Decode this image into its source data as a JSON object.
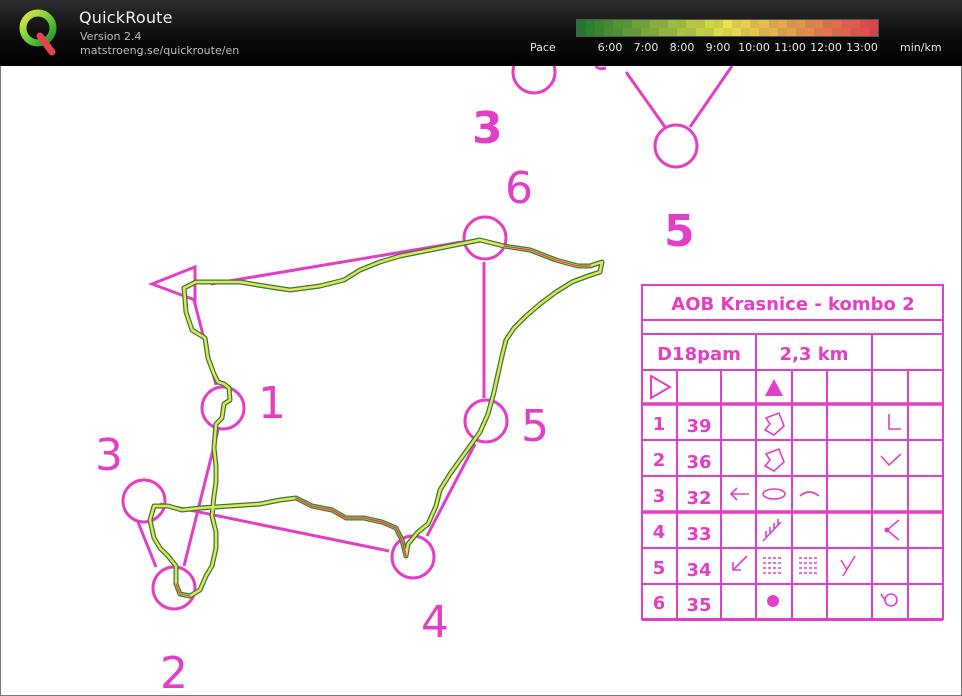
{
  "header": {
    "title": "QuickRoute",
    "version": "Version 2.4",
    "url": "matstroeng.se/quickroute/en",
    "pace_label": "Pace",
    "pace_ticks": [
      "6:00",
      "7:00",
      "8:00",
      "9:00",
      "10:00",
      "11:00",
      "12:00",
      "13:00"
    ],
    "unit": "min/km"
  },
  "colors": {
    "course": "#e33ec6",
    "route_fast": "#1f7a28",
    "route_mid": "#e8e34a",
    "route_slow": "#e0454a",
    "header_bg": "#111111"
  },
  "map": {
    "controls": [
      {
        "number": "1"
      },
      {
        "number": "2"
      },
      {
        "number": "3"
      },
      {
        "number": "4"
      },
      {
        "number": "5"
      },
      {
        "number": "6"
      }
    ],
    "background_labels": [
      "3",
      "5"
    ]
  },
  "description_sheet": {
    "title": "AOB Krasnice - kombo 2",
    "category": "D18pam",
    "length": "2,3 km",
    "rows": [
      {
        "number": "1",
        "code": "39"
      },
      {
        "number": "2",
        "code": "36"
      },
      {
        "number": "3",
        "code": "32"
      },
      {
        "number": "4",
        "code": "33"
      },
      {
        "number": "5",
        "code": "34"
      },
      {
        "number": "6",
        "code": "35"
      }
    ]
  }
}
